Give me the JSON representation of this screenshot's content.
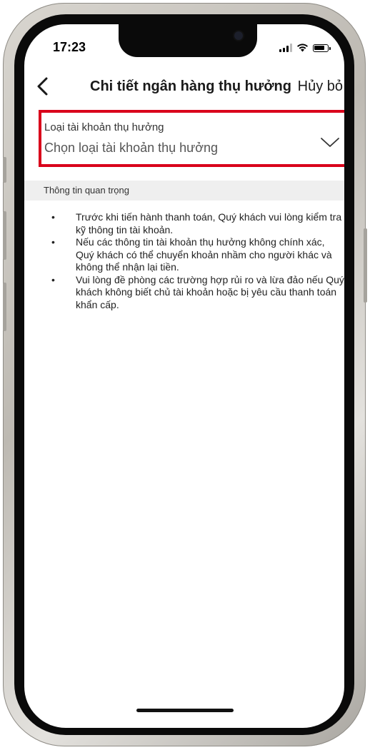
{
  "status_bar": {
    "time": "17:23",
    "icons": [
      "signal-icon",
      "wifi-icon",
      "battery-icon"
    ]
  },
  "nav": {
    "back_icon": "chevron-left-icon",
    "title": "Chi tiết ngân hàng thụ hưởng",
    "cancel_label": "Hủy bỏ"
  },
  "account_type_field": {
    "label": "Loại tài khoản thụ hưởng",
    "placeholder": "Chọn loại tài khoản thụ hưởng",
    "icon": "chevron-down-icon",
    "highlight_color": "#d9001b"
  },
  "info_section": {
    "header": "Thông tin quan trọng",
    "items": [
      "Trước khi tiến hành thanh toán, Quý khách vui lòng kiểm tra kỹ thông tin tài khoản.",
      "Nếu các thông tin tài khoản thụ hưởng không chính xác, Quý khách có thể chuyển khoản nhầm cho người khác và không thể nhận lại tiền.",
      "Vui lòng đề phòng các trường hợp rủi ro và lừa đảo nếu Quý khách không biết chủ tài khoản hoặc bị yêu cầu thanh toán khẩn cấp."
    ]
  }
}
